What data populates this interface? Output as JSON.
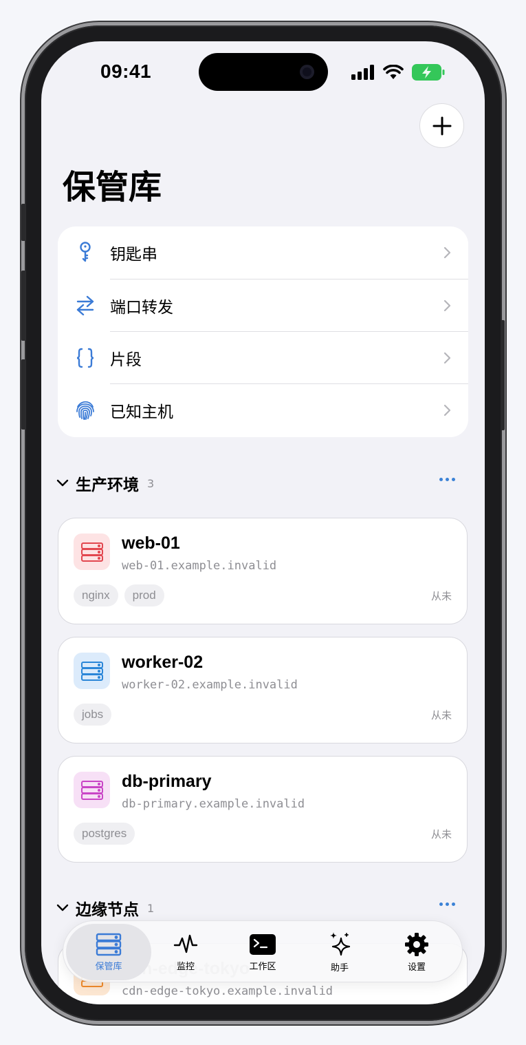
{
  "status_bar": {
    "time": "09:41"
  },
  "page": {
    "title": "保管库",
    "add_label": "+"
  },
  "menu": {
    "items": [
      {
        "label": "钥匙串",
        "icon": "key-icon"
      },
      {
        "label": "端口转发",
        "icon": "arrows-left-right-icon"
      },
      {
        "label": "片段",
        "icon": "braces-icon"
      },
      {
        "label": "已知主机",
        "icon": "fingerprint-icon"
      }
    ]
  },
  "groups": [
    {
      "title": "生产环境",
      "count": "3",
      "hosts": [
        {
          "name": "web-01",
          "address": "web-01.example.invalid",
          "tags": [
            "nginx",
            "prod"
          ],
          "last_seen": "从未",
          "color": "#e2474f",
          "bg": "#fde3e4"
        },
        {
          "name": "worker-02",
          "address": "worker-02.example.invalid",
          "tags": [
            "jobs"
          ],
          "last_seen": "从未",
          "color": "#2b86d8",
          "bg": "#dcebfb"
        },
        {
          "name": "db-primary",
          "address": "db-primary.example.invalid",
          "tags": [
            "postgres"
          ],
          "last_seen": "从未",
          "color": "#c945c6",
          "bg": "#f7e0f6"
        }
      ]
    },
    {
      "title": "边缘节点",
      "count": "1",
      "hosts": [
        {
          "name": "cdn-edge-tokyo",
          "address": "cdn-edge-tokyo.example.invalid",
          "color": "#f08a2b",
          "bg": "#fde7d2"
        }
      ]
    }
  ],
  "tab_bar": {
    "tabs": [
      {
        "label": "保管库",
        "icon": "server-icon",
        "active": true
      },
      {
        "label": "监控",
        "icon": "pulse-icon",
        "active": false
      },
      {
        "label": "工作区",
        "icon": "terminal-icon",
        "active": false
      },
      {
        "label": "助手",
        "icon": "sparkles-icon",
        "active": false
      },
      {
        "label": "设置",
        "icon": "gear-icon",
        "active": false
      }
    ]
  }
}
